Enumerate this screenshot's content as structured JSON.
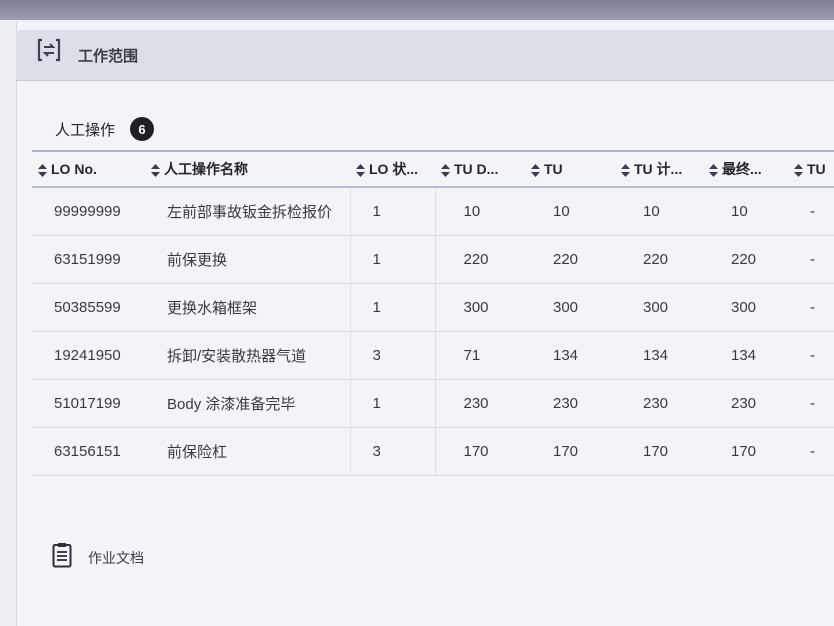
{
  "section": {
    "title": "工作范围",
    "icon": "scope-icon"
  },
  "manual_ops": {
    "title": "人工操作",
    "count": "6"
  },
  "table": {
    "columns": [
      "LO No.",
      "人工操作名称",
      "LO 状...",
      "TU D...",
      "TU",
      "TU 计...",
      "最终...",
      "TU"
    ],
    "rows": [
      [
        "99999999",
        "左前部事故钣金拆检报价",
        "1",
        "10",
        "10",
        "10",
        "10",
        "-"
      ],
      [
        "63151999",
        "前保更换",
        "1",
        "220",
        "220",
        "220",
        "220",
        "-"
      ],
      [
        "50385599",
        "更换水箱框架",
        "1",
        "300",
        "300",
        "300",
        "300",
        "-"
      ],
      [
        "19241950",
        "拆卸/安装散热器气道",
        "3",
        "71",
        "134",
        "134",
        "134",
        "-"
      ],
      [
        "51017199",
        "Body 涂漆准备完毕",
        "1",
        "230",
        "230",
        "230",
        "230",
        "-"
      ],
      [
        "63156151",
        "前保险杠",
        "3",
        "170",
        "170",
        "170",
        "170",
        "-"
      ]
    ]
  },
  "docs": {
    "title": "作业文档",
    "icon": "clipboard-icon"
  },
  "colors": {
    "badge": "#1f2024",
    "header_band": "#dcdfe8",
    "table_rule": "#a9b0c8"
  }
}
